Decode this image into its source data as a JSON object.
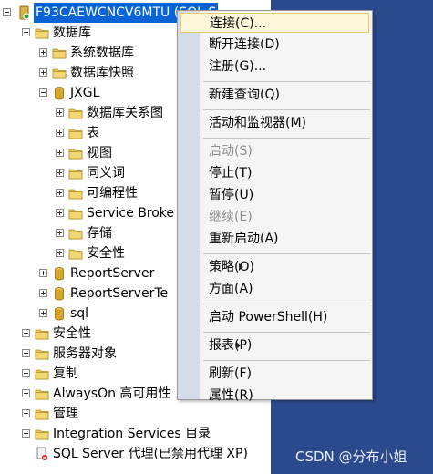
{
  "tree": {
    "server_label": "F93CAEWCNCV6MTU (SQL S",
    "nodes": [
      {
        "label": "数据库",
        "toggle": "minus",
        "icon": "folder",
        "level": 1
      },
      {
        "label": "系统数据库",
        "toggle": "plus",
        "icon": "folder",
        "level": 2
      },
      {
        "label": "数据库快照",
        "toggle": "plus",
        "icon": "folder",
        "level": 2
      },
      {
        "label": "JXGL",
        "toggle": "minus",
        "icon": "database",
        "level": 2
      },
      {
        "label": "数据库关系图",
        "toggle": "plus",
        "icon": "folder",
        "level": 3
      },
      {
        "label": "表",
        "toggle": "plus",
        "icon": "folder",
        "level": 3
      },
      {
        "label": "视图",
        "toggle": "plus",
        "icon": "folder",
        "level": 3
      },
      {
        "label": "同义词",
        "toggle": "plus",
        "icon": "folder",
        "level": 3
      },
      {
        "label": "可编程性",
        "toggle": "plus",
        "icon": "folder",
        "level": 3
      },
      {
        "label": "Service Broke",
        "toggle": "plus",
        "icon": "folder",
        "level": 3
      },
      {
        "label": "存储",
        "toggle": "plus",
        "icon": "folder",
        "level": 3
      },
      {
        "label": "安全性",
        "toggle": "plus",
        "icon": "folder",
        "level": 3
      },
      {
        "label": "ReportServer",
        "toggle": "plus",
        "icon": "database",
        "level": 2
      },
      {
        "label": "ReportServerTe",
        "toggle": "plus",
        "icon": "database",
        "level": 2
      },
      {
        "label": "sql",
        "toggle": "plus",
        "icon": "database",
        "level": 2
      },
      {
        "label": "安全性",
        "toggle": "plus",
        "icon": "folder",
        "level": 1
      },
      {
        "label": "服务器对象",
        "toggle": "plus",
        "icon": "folder",
        "level": 1
      },
      {
        "label": "复制",
        "toggle": "plus",
        "icon": "folder",
        "level": 1
      },
      {
        "label": "AlwaysOn 高可用性",
        "toggle": "plus",
        "icon": "folder",
        "level": 1
      },
      {
        "label": "管理",
        "toggle": "plus",
        "icon": "folder",
        "level": 1
      },
      {
        "label": "Integration Services 目录",
        "toggle": "plus",
        "icon": "folder",
        "level": 1
      },
      {
        "label": "SQL Server 代理(已禁用代理 XP)",
        "toggle": "none",
        "icon": "agent",
        "level": 1
      }
    ]
  },
  "menu": {
    "items": [
      {
        "label": "连接(C)...",
        "state": "highlighted"
      },
      {
        "label": "断开连接(D)",
        "state": "enabled"
      },
      {
        "label": "注册(G)...",
        "state": "enabled"
      },
      {
        "sep": true
      },
      {
        "label": "新建查询(Q)",
        "state": "enabled"
      },
      {
        "sep": true
      },
      {
        "label": "活动和监视器(M)",
        "state": "enabled"
      },
      {
        "sep": true
      },
      {
        "label": "启动(S)",
        "state": "disabled"
      },
      {
        "label": "停止(T)",
        "state": "enabled"
      },
      {
        "label": "暂停(U)",
        "state": "enabled"
      },
      {
        "label": "继续(E)",
        "state": "disabled"
      },
      {
        "label": "重新启动(A)",
        "state": "enabled"
      },
      {
        "sep": true
      },
      {
        "label": "策略(O)",
        "state": "enabled",
        "submenu": true
      },
      {
        "label": "方面(A)",
        "state": "enabled"
      },
      {
        "sep": true
      },
      {
        "label": "启动 PowerShell(H)",
        "state": "enabled"
      },
      {
        "sep": true
      },
      {
        "label": "报表(P)",
        "state": "enabled",
        "submenu": true
      },
      {
        "sep": true
      },
      {
        "label": "刷新(F)",
        "state": "enabled"
      },
      {
        "label": "属性(R)",
        "state": "enabled"
      }
    ]
  },
  "watermark": "CSDN @分布小姐",
  "colors": {
    "selection": "#0a64d6",
    "menu_gutter": "#d4dcea",
    "menu_highlight": "#fdf6d9",
    "background_strip": "#2b4a8e",
    "folder": "#e8c65a",
    "database": "#d9a62c"
  }
}
